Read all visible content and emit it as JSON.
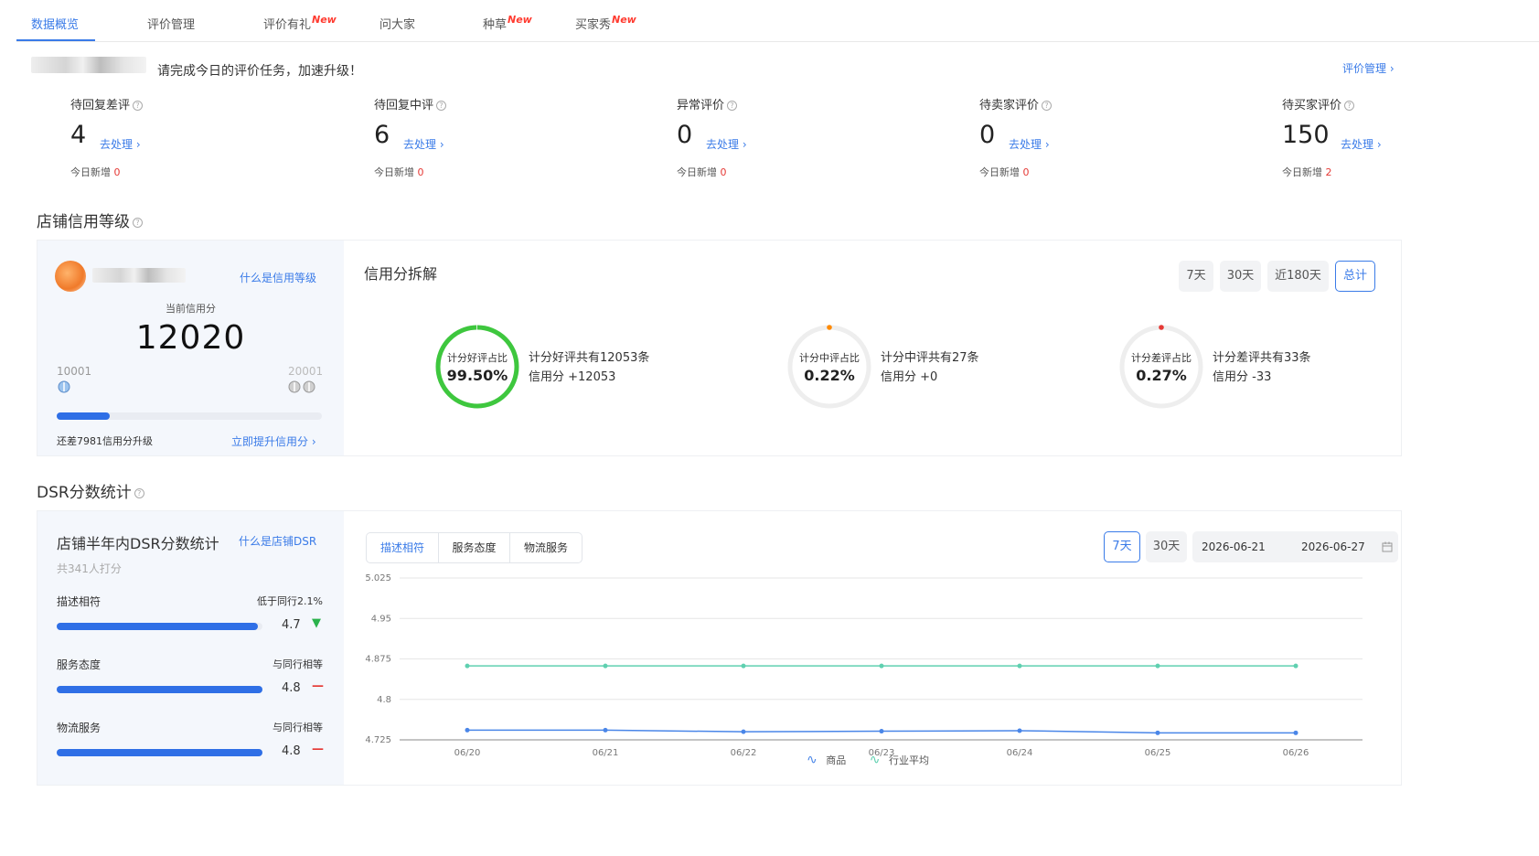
{
  "tabs": [
    {
      "label": "数据概览",
      "new": ""
    },
    {
      "label": "评价管理",
      "new": ""
    },
    {
      "label": "评价有礼",
      "new": "New"
    },
    {
      "label": "问大家",
      "new": ""
    },
    {
      "label": "种草",
      "new": "New"
    },
    {
      "label": "买家秀",
      "new": "New"
    }
  ],
  "header": {
    "notice": "请完成今日的评价任务，加速升级！",
    "manage_link": "评价管理 ›"
  },
  "stats": [
    {
      "label": "待回复差评",
      "value": "4",
      "action": "去处理 ›",
      "today_label": "今日新增",
      "today_value": "0"
    },
    {
      "label": "待回复中评",
      "value": "6",
      "action": "去处理 ›",
      "today_label": "今日新增",
      "today_value": "0"
    },
    {
      "label": "异常评价",
      "value": "0",
      "action": "去处理 ›",
      "today_label": "今日新增",
      "today_value": "0"
    },
    {
      "label": "待卖家评价",
      "value": "0",
      "action": "去处理 ›",
      "today_label": "今日新增",
      "today_value": "0"
    },
    {
      "label": "待买家评价",
      "value": "150",
      "action": "去处理 ›",
      "today_label": "今日新增",
      "today_value": "2"
    }
  ],
  "credit": {
    "section_title": "店铺信用等级",
    "what_link": "什么是信用等级",
    "score_label": "当前信用分",
    "score": "12020",
    "range_min": "10001",
    "range_max": "20001",
    "progress_percent": 20,
    "remaining": "还差7981信用分升级",
    "boost_link": "立即提升信用分 ›"
  },
  "breakdown": {
    "title": "信用分拆解",
    "periods": [
      "7天",
      "30天",
      "近180天",
      "总计"
    ],
    "active_period": "总计",
    "items": [
      {
        "ring_label": "计分好评占比",
        "ring_value": "99.50%",
        "desc1": "计分好评共有12053条",
        "desc2": "信用分 +12053",
        "color": "#3ec73e",
        "ratio": 0.995
      },
      {
        "ring_label": "计分中评占比",
        "ring_value": "0.22%",
        "desc1": "计分中评共有27条",
        "desc2": "信用分 +0",
        "color": "#ff8a00",
        "ratio": 0.0022
      },
      {
        "ring_label": "计分差评占比",
        "ring_value": "0.27%",
        "desc1": "计分差评共有33条",
        "desc2": "信用分 -33",
        "color": "#e53935",
        "ratio": 0.0027
      }
    ]
  },
  "dsr": {
    "section_title": "DSR分数统计",
    "panel_title": "店铺半年内DSR分数统计",
    "what_link": "什么是店铺DSR",
    "count": "共341人打分",
    "items": [
      {
        "label": "描述相符",
        "compare": "低于同行2.1%",
        "score": "4.7",
        "trend": "▼",
        "trend_color": "#2bb24c",
        "percent": 94
      },
      {
        "label": "服务态度",
        "compare": "与同行相等",
        "score": "4.8",
        "trend": "—",
        "trend_color": "#e53935",
        "percent": 96
      },
      {
        "label": "物流服务",
        "compare": "与同行相等",
        "score": "4.8",
        "trend": "—",
        "trend_color": "#e53935",
        "percent": 96
      }
    ],
    "tabs": [
      "描述相符",
      "服务态度",
      "物流服务"
    ],
    "active_tab": "描述相符",
    "periods": [
      "7天",
      "30天"
    ],
    "active_period": "7天",
    "date_start": "2026-06-21",
    "date_end": "2026-06-27"
  },
  "chart_data": {
    "type": "line",
    "x": [
      "06/20",
      "06/21",
      "06/22",
      "06/23",
      "06/24",
      "06/25",
      "06/26"
    ],
    "ylim": [
      4.725,
      5.025
    ],
    "yticks": [
      "5.025",
      "4.95",
      "4.875",
      "4.8",
      "4.725"
    ],
    "series": [
      {
        "name": "商品",
        "color": "#4a86e8",
        "values": [
          4.743,
          4.743,
          4.74,
          4.741,
          4.742,
          4.738,
          4.738
        ]
      },
      {
        "name": "行业平均",
        "color": "#5fd0b0",
        "values": [
          4.862,
          4.862,
          4.862,
          4.862,
          4.862,
          4.862,
          4.862
        ]
      }
    ],
    "legend": "bottom",
    "grid": true
  }
}
